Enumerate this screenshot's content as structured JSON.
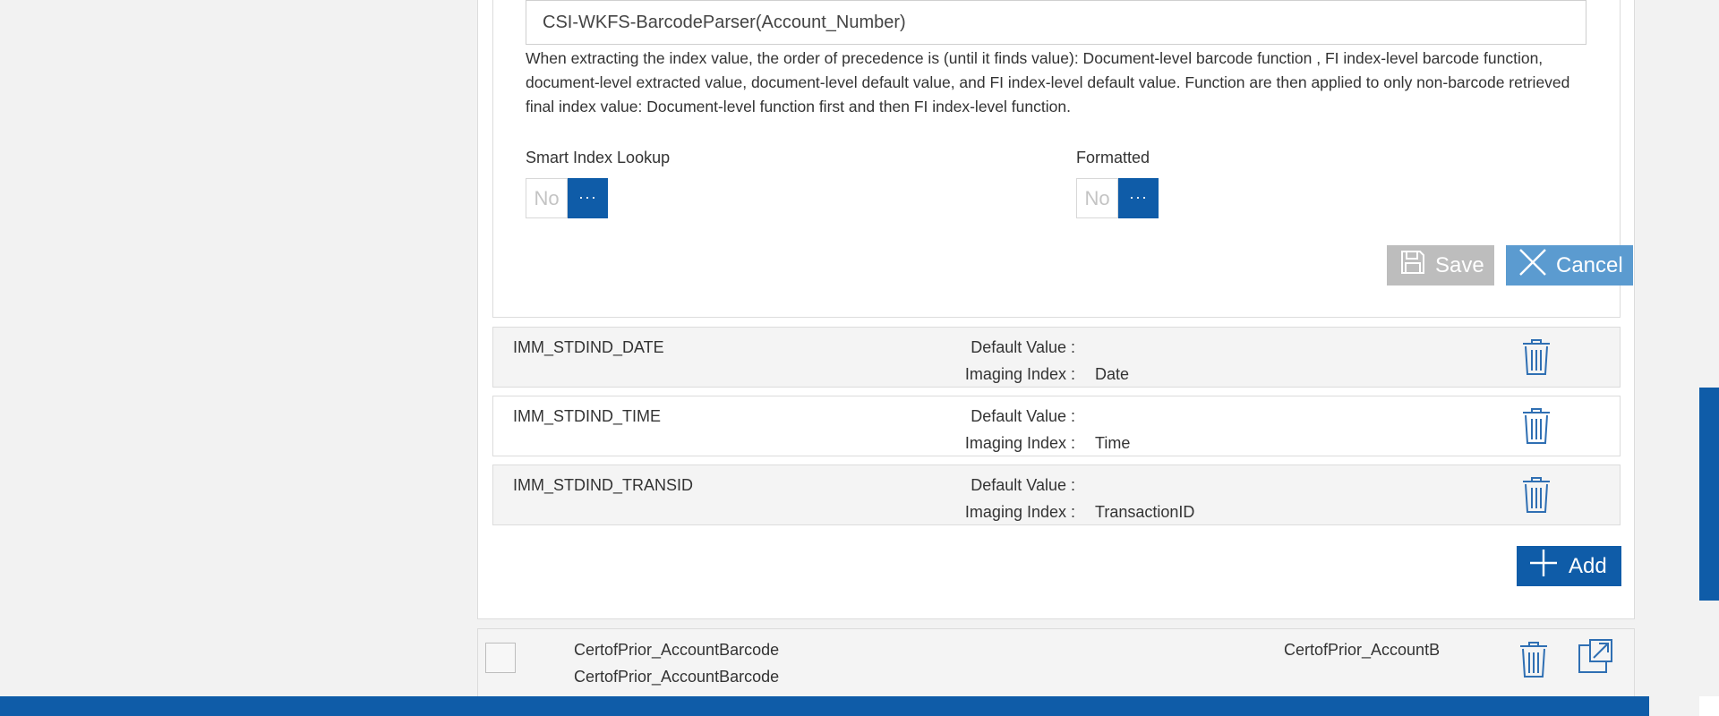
{
  "function_field": {
    "value": "CSI-WKFS-BarcodeParser(Account_Number)"
  },
  "help_text": "When extracting the index value, the order of precedence is (until it finds value): Document-level barcode function , FI index-level barcode function, document-level extracted value, document-level default value, and FI index-level default value. Function are then applied to only non-barcode retrieved final index value: Document-level function first and then FI index-level function.",
  "smart_index_lookup": {
    "label": "Smart Index Lookup",
    "value": "No",
    "button": "···"
  },
  "formatted": {
    "label": "Formatted",
    "value": "No",
    "button": "···"
  },
  "actions": {
    "save_label": "Save",
    "cancel_label": "Cancel",
    "add_label": "Add"
  },
  "index_rows": [
    {
      "name": "IMM_STDIND_DATE",
      "default_label": "Default Value :",
      "default_value": "",
      "imaging_label": "Imaging Index :",
      "imaging_value": "Date"
    },
    {
      "name": "IMM_STDIND_TIME",
      "default_label": "Default Value :",
      "default_value": "",
      "imaging_label": "Imaging Index :",
      "imaging_value": "Time"
    },
    {
      "name": "IMM_STDIND_TRANSID",
      "default_label": "Default Value :",
      "default_value": "",
      "imaging_label": "Imaging Index :",
      "imaging_value": "TransactionID"
    }
  ],
  "list_row": {
    "name_line1": "CertofPrior_AccountBarcode",
    "name_line2": "CertofPrior_AccountBarcode",
    "short_name": "CertofPrior_AccountB"
  },
  "colors": {
    "primary": "#0f5ca8",
    "cancel": "#5b9bd0",
    "disabled": "#bdbdbd"
  },
  "icons": {
    "save": "floppy-disk-icon",
    "cancel": "close-x-icon",
    "delete": "trash-icon",
    "add": "plus-icon",
    "open": "external-link-icon"
  }
}
